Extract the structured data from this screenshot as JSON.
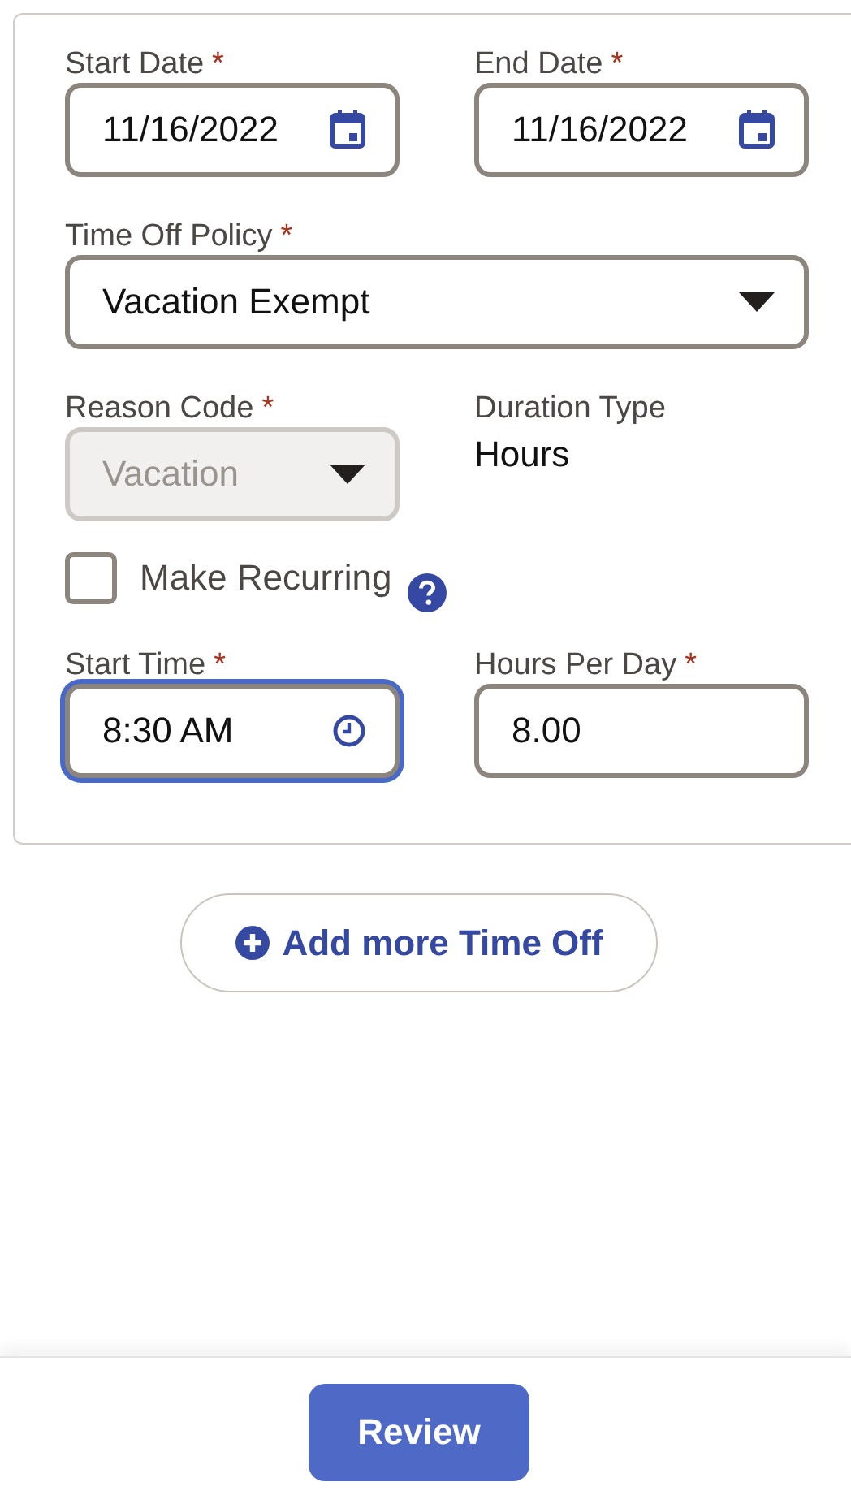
{
  "start_date": {
    "label": "Start Date",
    "required_mark": "*",
    "kind": "date",
    "value": "11/16/2022",
    "focused": false,
    "disabled": false
  },
  "end_date": {
    "label": "End Date",
    "required_mark": "*",
    "kind": "date",
    "value": "11/16/2022",
    "focused": false,
    "disabled": false
  },
  "time_off_policy": {
    "label": "Time Off Policy",
    "required_mark": "*",
    "kind": "select",
    "value": "Vacation Exempt",
    "focused": false,
    "disabled": false
  },
  "reason_code": {
    "label": "Reason Code",
    "required_mark": "*",
    "kind": "select",
    "value": "Vacation",
    "focused": false,
    "disabled": true
  },
  "duration_type": {
    "label": "Duration Type",
    "value": "Hours"
  },
  "make_recurring": {
    "label": "Make Recurring",
    "checked": false
  },
  "start_time": {
    "label": "Start Time",
    "required_mark": "*",
    "kind": "time",
    "value": "8:30 AM",
    "focused": true,
    "disabled": false
  },
  "hours_per_day": {
    "label": "Hours Per Day",
    "required_mark": "*",
    "kind": "text",
    "value": "8.00",
    "focused": false,
    "disabled": false
  },
  "add_button": {
    "label": "Add more Time Off"
  },
  "review_button": {
    "label": "Review"
  }
}
